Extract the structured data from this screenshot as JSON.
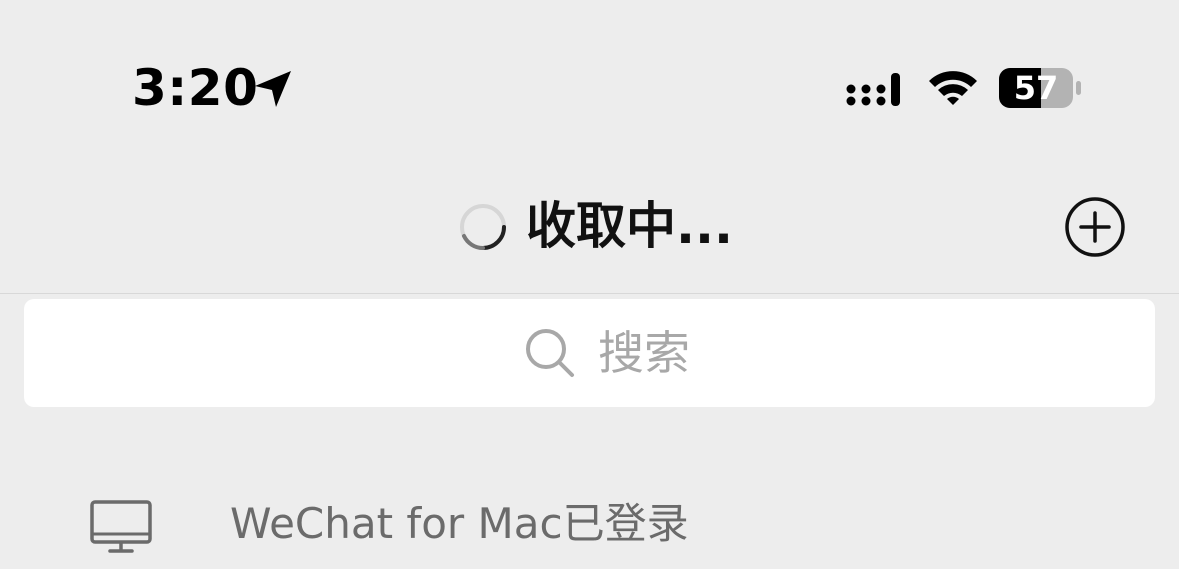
{
  "status_bar": {
    "time": "3:20",
    "battery_level": "57",
    "icons": [
      "location-arrow-icon",
      "cellular-signal-icon",
      "wifi-icon",
      "battery-icon"
    ]
  },
  "nav": {
    "title": "收取中...",
    "icons": [
      "loading-spinner-icon",
      "add-circle-icon"
    ]
  },
  "search": {
    "placeholder": "搜索",
    "icon": "search-icon"
  },
  "login_banner": {
    "text": "WeChat for Mac已登录",
    "icon": "monitor-icon"
  },
  "colors": {
    "background": "#ededed",
    "search_box": "#ffffff",
    "placeholder": "#a8a8a8",
    "banner_text": "#6b6b6b",
    "title": "#111111"
  }
}
